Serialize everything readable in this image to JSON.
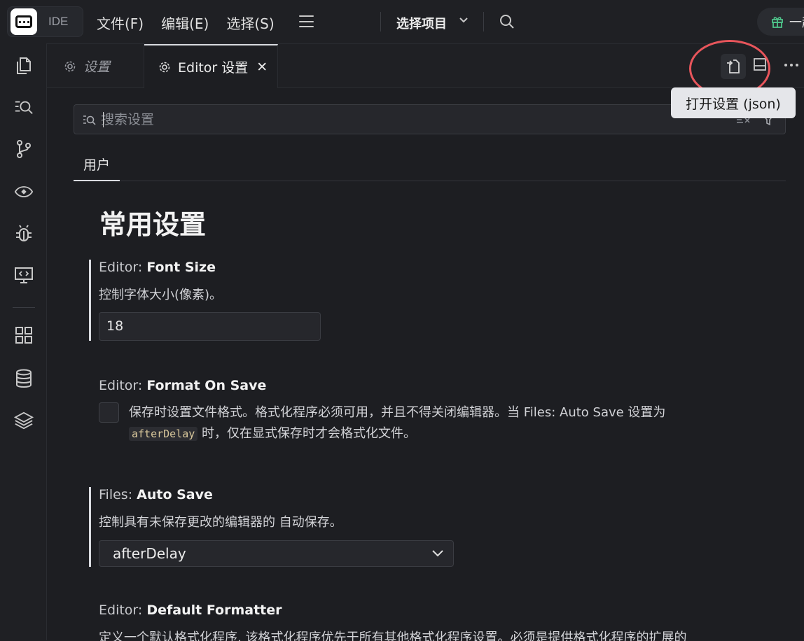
{
  "titlebar": {
    "logo_text": "IDE",
    "menus": [
      "文件(F)",
      "编辑(E)",
      "选择(S)"
    ],
    "project_label": "选择项目",
    "pill_text": "一起"
  },
  "tabs": [
    {
      "label": "设置",
      "active": false
    },
    {
      "label": "Editor 设置",
      "active": true
    }
  ],
  "tab_close": "✕",
  "tooltip": "打开设置 (json)",
  "search": {
    "placeholder": "搜索设置",
    "value": ""
  },
  "scope_tab": "用户",
  "section_title": "常用设置",
  "settings": {
    "font_size": {
      "category": "Editor: ",
      "key": "Font Size",
      "description": "控制字体大小(像素)。",
      "value": "18"
    },
    "format_on_save": {
      "category": "Editor: ",
      "key": "Format On Save",
      "description_line1": "保存时设置文件格式。格式化程序必须可用，并且不得关闭编辑器。当 Files: Auto Save 设置为",
      "code": "afterDelay",
      "description_line2": " 时，仅在显式保存时才会格式化文件。",
      "checked": false
    },
    "auto_save": {
      "category": "Files: ",
      "key": "Auto Save",
      "description": "控制具有未保存更改的编辑器的 自动保存。",
      "value": "afterDelay"
    },
    "default_formatter": {
      "category": "Editor: ",
      "key": "Default Formatter",
      "description": "定义一个默认格式化程序, 该格式化程序优先于所有其他格式化程序设置。必须是提供格式化程序的扩展的"
    }
  },
  "colors": {
    "highlight_ring": "#e8555b",
    "gift_icon": "#4ec38a"
  }
}
